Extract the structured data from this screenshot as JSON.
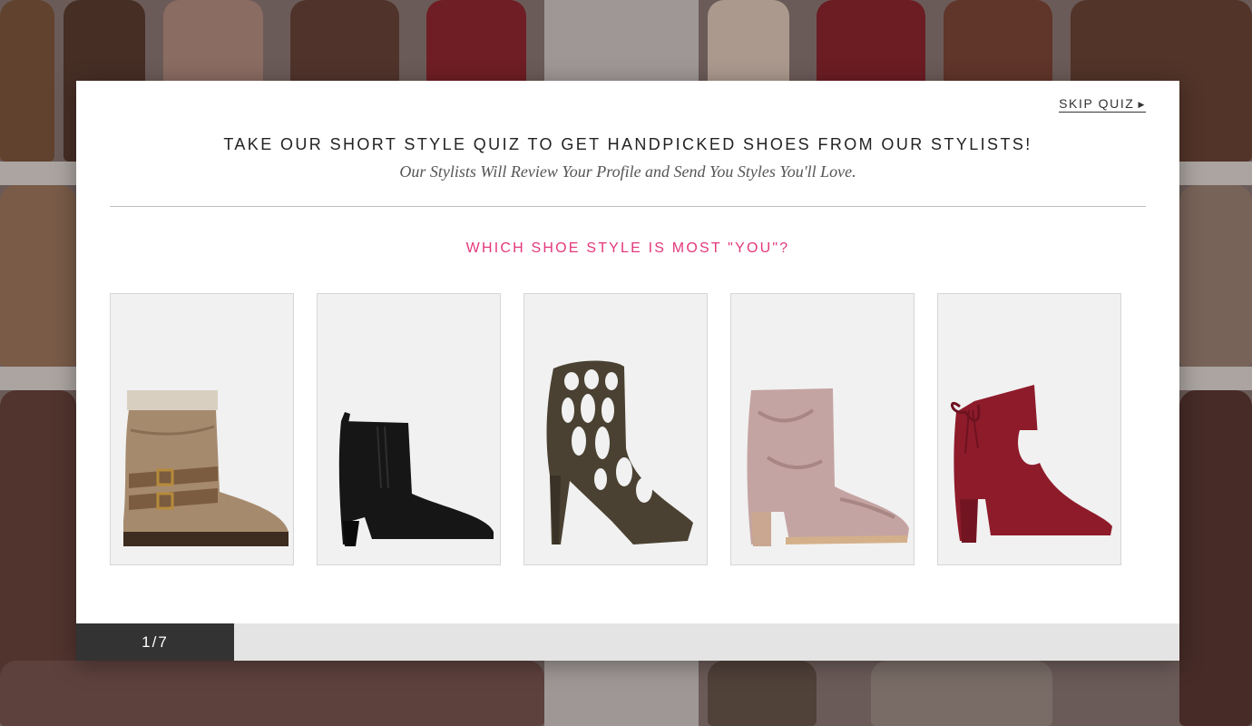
{
  "quiz": {
    "skip_label": "SKIP QUIZ",
    "headline": "TAKE OUR SHORT STYLE QUIZ TO GET HANDPICKED SHOES FROM OUR STYLISTS!",
    "subheadline": "Our Stylists Will Review Your Profile and Send You Styles You'll Love.",
    "question": "WHICH SHOE STYLE IS MOST \"YOU\"?",
    "options": [
      {
        "name": "slouch-buckle-boot",
        "icon": "tan-slouch-boot-icon"
      },
      {
        "name": "black-chelsea-bootie",
        "icon": "black-bootie-icon"
      },
      {
        "name": "cutout-cage-heel",
        "icon": "cutout-heel-icon"
      },
      {
        "name": "velvet-block-heel-bootie",
        "icon": "velvet-bootie-icon"
      },
      {
        "name": "burgundy-bow-bootie",
        "icon": "bow-bootie-icon"
      }
    ],
    "progress": {
      "label": "1/7",
      "current": 1,
      "total": 7
    }
  },
  "colors": {
    "accent": "#e2387b",
    "progress_fill": "#333333",
    "progress_track": "#e4e4e4",
    "text": "#222222"
  }
}
